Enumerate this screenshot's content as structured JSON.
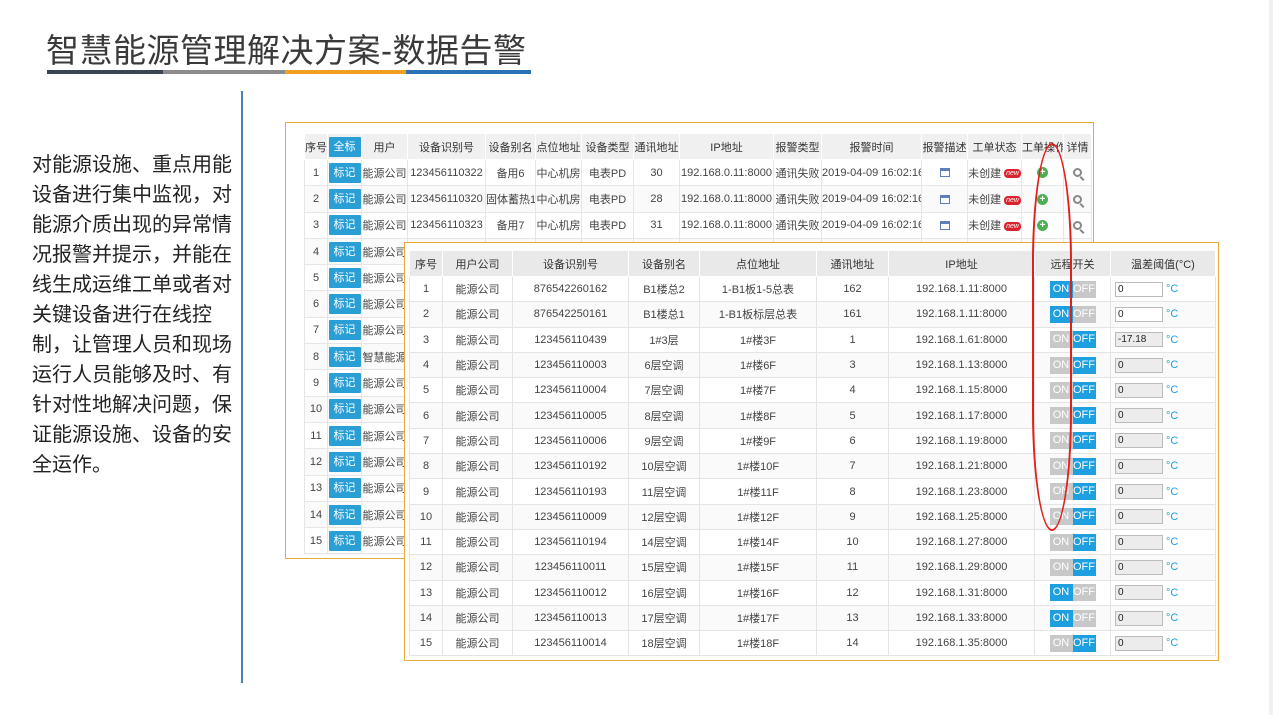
{
  "slide": {
    "title": "智慧能源管理解决方案-数据告警",
    "description": "对能源设施、重点用能设备进行集中监视，对能源介质出现的异常情况报警并提示，并能在线生成运维工单或者对关键设备进行在线控制，让管理人员和现场运行人员能够及时、有针对性地解决问题，保证能源设施、设备的安全运作。",
    "underline_colors": [
      "#3b4453",
      "#8c8c8c",
      "#f0a020",
      "#2b72b8"
    ]
  },
  "alarm_table": {
    "columns": [
      "序号",
      "全标",
      "用户",
      "设备识别号",
      "设备别名",
      "点位地址",
      "设备类型",
      "通讯地址",
      "IP地址",
      "报警类型",
      "报警时间",
      "报警描述",
      "工单状态",
      "工单操作",
      "详情"
    ],
    "mark_label": "标记",
    "new_badge": "new",
    "rows": [
      {
        "no": "1",
        "user": "能源公司",
        "device_id": "123456110322",
        "alias": "备用6",
        "location": "中心机房",
        "type": "电表PD",
        "comm": "30",
        "ip": "192.168.0.11:8000",
        "alarm_type": "通讯失败",
        "time": "2019-04-09 16:02:16",
        "status": "未创建"
      },
      {
        "no": "2",
        "user": "能源公司",
        "device_id": "123456110320",
        "alias": "固体蓄热1",
        "location": "中心机房",
        "type": "电表PD",
        "comm": "28",
        "ip": "192.168.0.11:8000",
        "alarm_type": "通讯失败",
        "time": "2019-04-09 16:02:16",
        "status": "未创建"
      },
      {
        "no": "3",
        "user": "能源公司",
        "device_id": "123456110323",
        "alias": "备用7",
        "location": "中心机房",
        "type": "电表PD",
        "comm": "31",
        "ip": "192.168.0.11:8000",
        "alarm_type": "通讯失败",
        "time": "2019-04-09 16:02:16",
        "status": "未创建"
      },
      {
        "no": "4",
        "user": "能源公司"
      },
      {
        "no": "5",
        "user": "能源公司"
      },
      {
        "no": "6",
        "user": "能源公司"
      },
      {
        "no": "7",
        "user": "能源公司"
      },
      {
        "no": "8",
        "user": "智慧能源"
      },
      {
        "no": "9",
        "user": "能源公司"
      },
      {
        "no": "10",
        "user": "能源公司"
      },
      {
        "no": "11",
        "user": "能源公司"
      },
      {
        "no": "12",
        "user": "能源公司"
      },
      {
        "no": "13",
        "user": "能源公司"
      },
      {
        "no": "14",
        "user": "能源公司"
      },
      {
        "no": "15",
        "user": "能源公司"
      }
    ]
  },
  "control_table": {
    "columns": [
      "序号",
      "用户公司",
      "设备识别号",
      "设备别名",
      "点位地址",
      "通讯地址",
      "IP地址",
      "远程开关",
      "温差阈值(°C)"
    ],
    "on_label": "ON",
    "off_label": "OFF",
    "unit": "°C",
    "rows": [
      {
        "no": "1",
        "company": "能源公司",
        "device_id": "876542260162",
        "alias": "B1楼总2",
        "location": "1-B1板1-5总表",
        "comm": "162",
        "ip": "192.168.1.11:8000",
        "state": "on",
        "threshold": "0",
        "editable": true
      },
      {
        "no": "2",
        "company": "能源公司",
        "device_id": "876542250161",
        "alias": "B1楼总1",
        "location": "1-B1板标层总表",
        "comm": "161",
        "ip": "192.168.1.11:8000",
        "state": "on",
        "threshold": "0",
        "editable": true
      },
      {
        "no": "3",
        "company": "能源公司",
        "device_id": "123456110439",
        "alias": "1#3层",
        "location": "1#楼3F",
        "comm": "1",
        "ip": "192.168.1.61:8000",
        "state": "off",
        "threshold": "-17.18",
        "editable": false
      },
      {
        "no": "4",
        "company": "能源公司",
        "device_id": "123456110003",
        "alias": "6层空调",
        "location": "1#楼6F",
        "comm": "3",
        "ip": "192.168.1.13:8000",
        "state": "off",
        "threshold": "0",
        "editable": false
      },
      {
        "no": "5",
        "company": "能源公司",
        "device_id": "123456110004",
        "alias": "7层空调",
        "location": "1#楼7F",
        "comm": "4",
        "ip": "192.168.1.15:8000",
        "state": "off",
        "threshold": "0",
        "editable": false
      },
      {
        "no": "6",
        "company": "能源公司",
        "device_id": "123456110005",
        "alias": "8层空调",
        "location": "1#楼8F",
        "comm": "5",
        "ip": "192.168.1.17:8000",
        "state": "off",
        "threshold": "0",
        "editable": false
      },
      {
        "no": "7",
        "company": "能源公司",
        "device_id": "123456110006",
        "alias": "9层空调",
        "location": "1#楼9F",
        "comm": "6",
        "ip": "192.168.1.19:8000",
        "state": "off",
        "threshold": "0",
        "editable": false
      },
      {
        "no": "8",
        "company": "能源公司",
        "device_id": "123456110192",
        "alias": "10层空调",
        "location": "1#楼10F",
        "comm": "7",
        "ip": "192.168.1.21:8000",
        "state": "off",
        "threshold": "0",
        "editable": false
      },
      {
        "no": "9",
        "company": "能源公司",
        "device_id": "123456110193",
        "alias": "11层空调",
        "location": "1#楼11F",
        "comm": "8",
        "ip": "192.168.1.23:8000",
        "state": "off",
        "threshold": "0",
        "editable": false
      },
      {
        "no": "10",
        "company": "能源公司",
        "device_id": "123456110009",
        "alias": "12层空调",
        "location": "1#楼12F",
        "comm": "9",
        "ip": "192.168.1.25:8000",
        "state": "off",
        "threshold": "0",
        "editable": false
      },
      {
        "no": "11",
        "company": "能源公司",
        "device_id": "123456110194",
        "alias": "14层空调",
        "location": "1#楼14F",
        "comm": "10",
        "ip": "192.168.1.27:8000",
        "state": "off",
        "threshold": "0",
        "editable": false
      },
      {
        "no": "12",
        "company": "能源公司",
        "device_id": "123456110011",
        "alias": "15层空调",
        "location": "1#楼15F",
        "comm": "11",
        "ip": "192.168.1.29:8000",
        "state": "off",
        "threshold": "0",
        "editable": false
      },
      {
        "no": "13",
        "company": "能源公司",
        "device_id": "123456110012",
        "alias": "16层空调",
        "location": "1#楼16F",
        "comm": "12",
        "ip": "192.168.1.31:8000",
        "state": "on",
        "threshold": "0",
        "editable": false
      },
      {
        "no": "14",
        "company": "能源公司",
        "device_id": "123456110013",
        "alias": "17层空调",
        "location": "1#楼17F",
        "comm": "13",
        "ip": "192.168.1.33:8000",
        "state": "on",
        "threshold": "0",
        "editable": false
      },
      {
        "no": "15",
        "company": "能源公司",
        "device_id": "123456110014",
        "alias": "18层空调",
        "location": "1#楼18F",
        "comm": "14",
        "ip": "192.168.1.35:8000",
        "state": "off",
        "threshold": "0",
        "editable": false
      }
    ]
  }
}
